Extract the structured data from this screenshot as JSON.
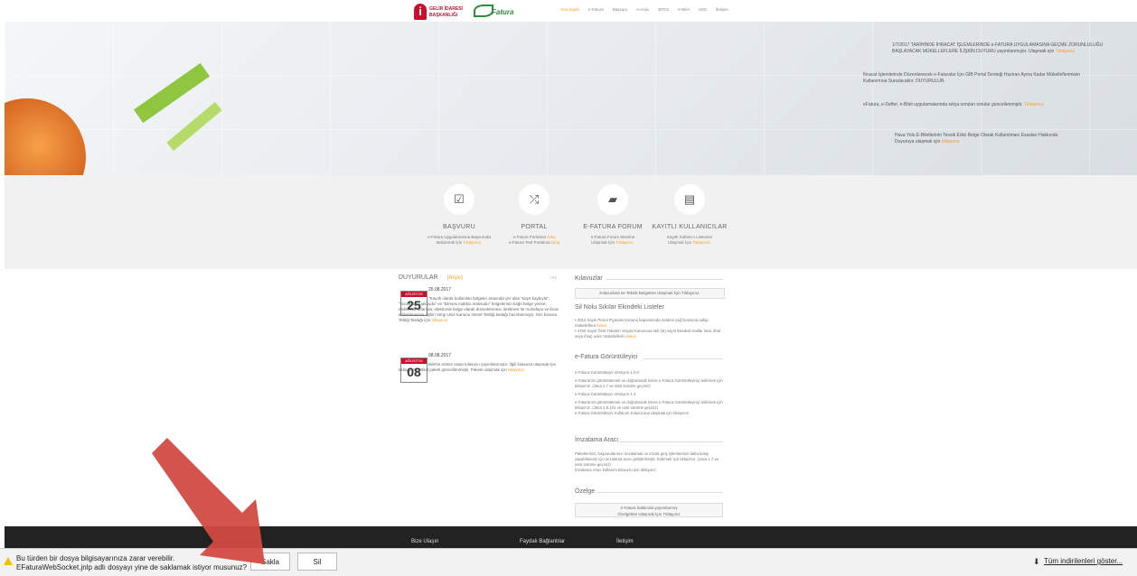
{
  "header": {
    "gib_line1": "GELİR İDARESİ",
    "gib_line2": "BAŞKANLIĞI",
    "efatura_logo": "Fatura",
    "nav": [
      "Ana Sayfa",
      "e-Fatura",
      "Başvuru",
      "e-Arşiv",
      "EFKS",
      "e-Bilet",
      "SSS",
      "İletişim"
    ]
  },
  "hero_news": [
    {
      "text": "1/7/2017 TARİHİNDE İHRACAT İŞLEMLERİNDE e-FATURA UYGULAMASINA GEÇME ZORUNLULUĞU BAŞLAYACAK MÜKELLEFLERE İLİŞKİN DUYURU yayımlanmıştır. Ulaşmak için",
      "more": "Tıklayınız."
    },
    {
      "text": "İhracat İşlemlerinde Düzenlenecek e-Faturalar İçin GİB Portal Desteği Haziran Ayına Kadar Mükelleflerimizin Kullanımına Sunulacaktır. DUYURULUR.",
      "more": ""
    },
    {
      "text": "eFatura, e-Defter, e-Bilet uygulamalarında sıkça sorulan sorular güncellenmiştir.",
      "more": "Tıklayınız."
    },
    {
      "text": "Hava Yolu E-Biletlerinin Tevsik Edici Belge Olarak Kullanılması Esasları Hakkında Duyuruya ulaşmak için",
      "more": "tıklayınız."
    }
  ],
  "features": [
    {
      "icon": "checkbox-icon",
      "glyph": "☑",
      "title": "BAŞVURU",
      "desc1": "e-Fatura Uygulamasına Başvuruda",
      "desc2": "Bulunmak İçin",
      "link": "Tıklayınız."
    },
    {
      "icon": "shuffle-icon",
      "glyph": "⤮",
      "title": "PORTAL",
      "desc1": "e-Fatura Portalına",
      "desc1_link": "Giriş",
      "desc2": "e-Fatura Test Portalına",
      "link": "Giriş"
    },
    {
      "icon": "book-icon",
      "glyph": "▰",
      "title": "E-FATURA FORUM",
      "desc1": "e-Fatura Forum Sitesine",
      "desc2": "Ulaşmak İçin",
      "link": "Tıklayınız."
    },
    {
      "icon": "list-icon",
      "glyph": "▤",
      "title": "KAYITLI KULLANICILAR",
      "desc1": "Kayıtlı Kullanıcı Listesine",
      "desc2": "Ulaşmak İçin",
      "link": "Tıklayınız."
    }
  ],
  "announcements": {
    "title": "DUYURULAR",
    "archive": "(Arşiv)",
    "rss": "rss",
    "items": [
      {
        "month": "AĞUSTOS",
        "day": "25",
        "date": "25.08.2017",
        "text": "\"Kayıtlı olarak kullanılan belgeler arasında yer alan \"kayıt kaybıyla\", \"hizaladan maksudu\" ve \"bilmesi makbis maksudu\" belgelerinin kağıt belge yerine, elektronik ortamda; elektronik belge olarak düzenlenmesi, iletilmesi ile muhafaza ve ibraz edilebilmesine ilişkin Vergi Usul Kanunu Genel Tebliği taslağı hazırlanmıştır. Söz konusu Tebliğ Taslağı için",
        "more": "tıklayınız."
      },
      {
        "month": "AĞUSTOS",
        "day": "08",
        "date": "08.08.2017",
        "text": "Bilirkin entrez ıssan kılavuzu yayımlanmıştır. İlgili kılavuza ulaşmak için tıklayınız. e-Bilet paketi güncellenmiştir. Pakete ulaşmak için",
        "more": "tıklayınız."
      }
    ]
  },
  "right_col": {
    "kilavuzlar": "Kılavuzlar",
    "kilavuz_btn": "Kılavuzlara ve Teknik Belgelere Ulaşmak İçin Tıklayınız.",
    "sil_title": "Sil Nolu Sıkılar Ekindeki Listeler",
    "sil_text1": "• 2012 Sayılı Petrol Piyasası Kanunu kapsamında madeni yağ lisansına sahip mükelleflere",
    "sil_text2": "• 4760 Sayılı Özel Tüketim Vergisi Kanununa ekli (III) sayılı listedeki mallar imal, ithal veya ihraç eden mükelleflerin",
    "sil_link": "listesi",
    "goruntuleyici_title": "e-Fatura Görüntüleyici",
    "g1": "e-Fatura Görüntüleyici Versiyon 1.0.0",
    "g2": "e-Faturanızı görüntülemek ve doğrulamak üzere e-Fatura Görüntüleyiciyi indirmek için tıklayınız. (Java 1.7 ve üstü sürüme geçiniz)",
    "g3": "e-Fatura Görüntüleyici Versiyon 1.4",
    "g4": "e-Faturanızı görüntülemek ve doğrulamak üzere e-Fatura Görüntüleyiciyi indirmek için tıklayınız. (Java 1.8.101 ve üstü sürüme geçiniz)",
    "g5": "e-Fatura Görüntüleyici Kullanım Kılavuzuna ulaşmak için tıklayınız.",
    "imzalama_title": "İmzalama Aracı",
    "i1": "Paketlerinizi, başvurularınızı imzalamak ve imzalı giriş işlemlerinizi daha kolay yapabilmeniz için imzalama aracı geliştirilmiştir. İndirmek için tıklayınız. (Java 1.7 ve üstü sürüme geçiniz)",
    "i2": "İmzalama Aracı kullanım kılavuzu için tıklayınız.",
    "ozelge_title": "Özelge",
    "ozelge_btn1": "e-Fatura hakkında yayımlanmış",
    "ozelge_btn2": "Özelgelere Ulaşmak İçin Tıklayınız"
  },
  "footer": {
    "c1": "Bize Ulaşın",
    "c2": "Faydalı Bağlantılar",
    "c3": "İletişim"
  },
  "download_bar": {
    "line1": "Bu türden bir dosya bilgisayarınıza zarar verebilir.",
    "line2": "EFaturaWebSocket.jnlp adlı dosyayı yine de saklamak istiyor musunuz?",
    "keep": "Sakla",
    "discard": "Sil",
    "show_all": "Tüm indirilenleri göster..."
  }
}
